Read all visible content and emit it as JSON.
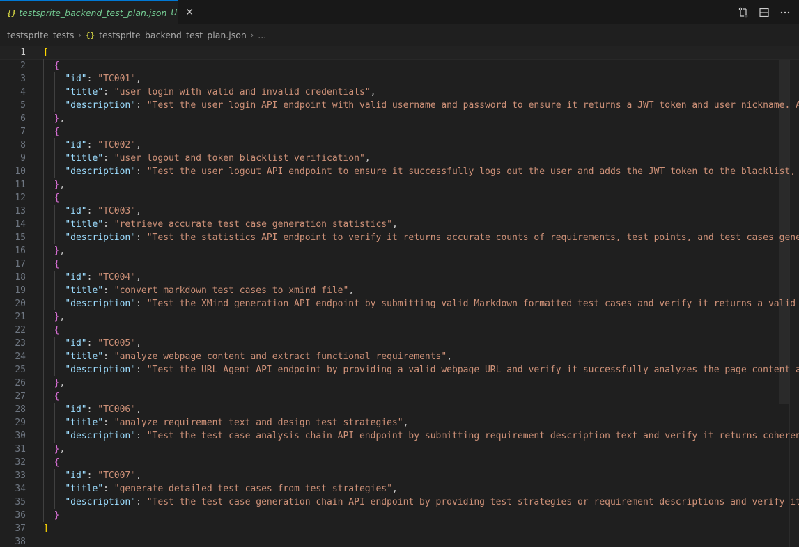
{
  "tab": {
    "icon": "{}",
    "filename": "testsprite_backend_test_plan.json",
    "status": "U",
    "close": "✕"
  },
  "breadcrumb": {
    "folder": "testsprite_tests",
    "file_icon": "{}",
    "file": "testsprite_backend_test_plan.json",
    "more": "..."
  },
  "lines": [
    {
      "n": "1",
      "type": "open_array",
      "text": "["
    },
    {
      "n": "2",
      "type": "open_obj",
      "text": "{"
    },
    {
      "n": "3",
      "type": "kv",
      "key": "\"id\"",
      "value": "\"TC001\""
    },
    {
      "n": "4",
      "type": "kv",
      "key": "\"title\"",
      "value": "\"user login with valid and invalid credentials\""
    },
    {
      "n": "5",
      "type": "kv",
      "key": "\"description\"",
      "value": "\"Test the user login API endpoint with valid username and password to ensure it returns a JWT token and user nickname. Al"
    },
    {
      "n": "6",
      "type": "close_obj",
      "text": "},"
    },
    {
      "n": "7",
      "type": "open_obj",
      "text": "{"
    },
    {
      "n": "8",
      "type": "kv",
      "key": "\"id\"",
      "value": "\"TC002\""
    },
    {
      "n": "9",
      "type": "kv",
      "key": "\"title\"",
      "value": "\"user logout and token blacklist verification\""
    },
    {
      "n": "10",
      "type": "kv",
      "key": "\"description\"",
      "value": "\"Test the user logout API endpoint to ensure it successfully logs out the user and adds the JWT token to the blacklist, p"
    },
    {
      "n": "11",
      "type": "close_obj",
      "text": "},"
    },
    {
      "n": "12",
      "type": "open_obj",
      "text": "{"
    },
    {
      "n": "13",
      "type": "kv",
      "key": "\"id\"",
      "value": "\"TC003\""
    },
    {
      "n": "14",
      "type": "kv",
      "key": "\"title\"",
      "value": "\"retrieve accurate test case generation statistics\""
    },
    {
      "n": "15",
      "type": "kv",
      "key": "\"description\"",
      "value": "\"Test the statistics API endpoint to verify it returns accurate counts of requirements, test points, and test cases gener"
    },
    {
      "n": "16",
      "type": "close_obj",
      "text": "},"
    },
    {
      "n": "17",
      "type": "open_obj",
      "text": "{"
    },
    {
      "n": "18",
      "type": "kv",
      "key": "\"id\"",
      "value": "\"TC004\""
    },
    {
      "n": "19",
      "type": "kv",
      "key": "\"title\"",
      "value": "\"convert markdown test cases to xmind file\""
    },
    {
      "n": "20",
      "type": "kv",
      "key": "\"description\"",
      "value": "\"Test the XMind generation API endpoint by submitting valid Markdown formatted test cases and verify it returns a valid ("
    },
    {
      "n": "21",
      "type": "close_obj",
      "text": "},"
    },
    {
      "n": "22",
      "type": "open_obj",
      "text": "{"
    },
    {
      "n": "23",
      "type": "kv",
      "key": "\"id\"",
      "value": "\"TC005\""
    },
    {
      "n": "24",
      "type": "kv",
      "key": "\"title\"",
      "value": "\"analyze webpage content and extract functional requirements\""
    },
    {
      "n": "25",
      "type": "kv",
      "key": "\"description\"",
      "value": "\"Test the URL Agent API endpoint by providing a valid webpage URL and verify it successfully analyzes the page content ar"
    },
    {
      "n": "26",
      "type": "close_obj",
      "text": "},"
    },
    {
      "n": "27",
      "type": "open_obj",
      "text": "{"
    },
    {
      "n": "28",
      "type": "kv",
      "key": "\"id\"",
      "value": "\"TC006\""
    },
    {
      "n": "29",
      "type": "kv",
      "key": "\"title\"",
      "value": "\"analyze requirement text and design test strategies\""
    },
    {
      "n": "30",
      "type": "kv",
      "key": "\"description\"",
      "value": "\"Test the test case analysis chain API endpoint by submitting requirement description text and verify it returns coherent"
    },
    {
      "n": "31",
      "type": "close_obj",
      "text": "},"
    },
    {
      "n": "32",
      "type": "open_obj",
      "text": "{"
    },
    {
      "n": "33",
      "type": "kv",
      "key": "\"id\"",
      "value": "\"TC007\""
    },
    {
      "n": "34",
      "type": "kv",
      "key": "\"title\"",
      "value": "\"generate detailed test cases from test strategies\""
    },
    {
      "n": "35",
      "type": "kv",
      "key": "\"description\"",
      "value": "\"Test the test case generation chain API endpoint by providing test strategies or requirement descriptions and verify it"
    },
    {
      "n": "36",
      "type": "close_last",
      "text": "}"
    },
    {
      "n": "37",
      "type": "close_array",
      "text": "]"
    },
    {
      "n": "38",
      "type": "empty",
      "text": ""
    }
  ]
}
